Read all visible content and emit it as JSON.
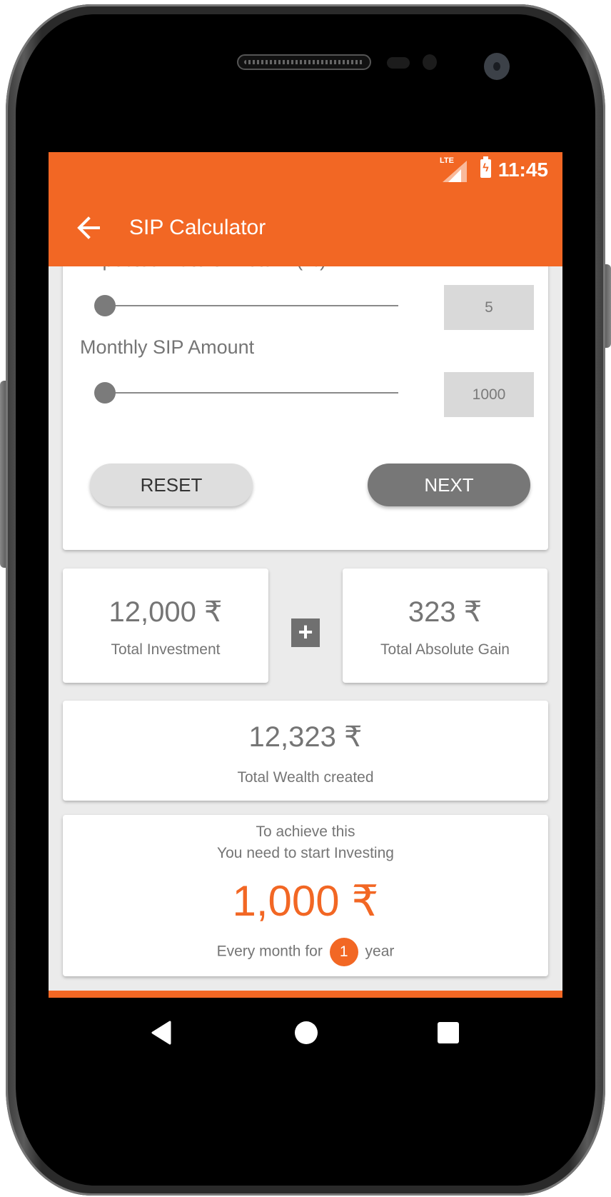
{
  "status_bar": {
    "network_label": "LTE",
    "time": "11:45",
    "battery_icon": "battery-charging-icon",
    "signal_icon": "signal-icon"
  },
  "toolbar": {
    "back_icon": "arrow-left-icon",
    "title": "SIP Calculator"
  },
  "inputs": {
    "rate_label": "Expected Rate of Return (%)",
    "rate_value": "5",
    "rate_slider_fraction": 0,
    "amount_label": "Monthly SIP Amount",
    "amount_value": "1000",
    "amount_slider_fraction": 0,
    "reset_label": "RESET",
    "next_label": "NEXT"
  },
  "results": {
    "total_investment_value": "12,000 ₹",
    "total_investment_label": "Total Investment",
    "plus_icon": "plus-icon",
    "absolute_gain_value": "323 ₹",
    "absolute_gain_label": "Total Absolute Gain",
    "wealth_value": "12,323 ₹",
    "wealth_label": "Total Wealth created"
  },
  "summary": {
    "line1": "To achieve this",
    "line2": "You need to start Investing",
    "amount": "1,000 ₹",
    "prefix": "Every month for",
    "years": "1",
    "suffix": "year"
  },
  "nav_bar": {
    "back_icon": "nav-back-icon",
    "home_icon": "nav-home-icon",
    "recents_icon": "nav-recents-icon"
  },
  "colors": {
    "accent": "#f26724",
    "background": "#ebebeb",
    "text_secondary": "#757575"
  }
}
